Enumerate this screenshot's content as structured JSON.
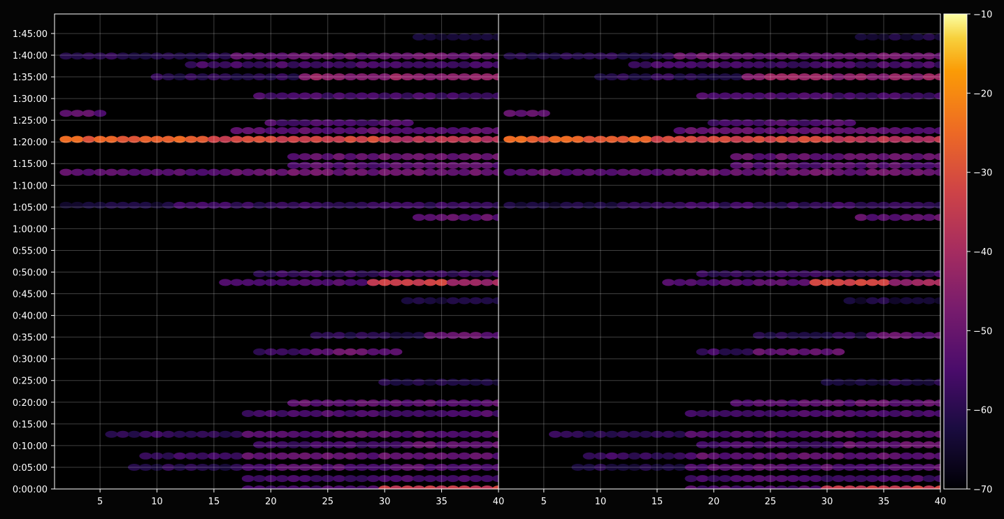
{
  "chart_data": {
    "type": "heatmap",
    "title": "",
    "xlabel": "",
    "ylabel": "",
    "background": "#050505",
    "colormap": "inferno",
    "grid": true,
    "panels": [
      {
        "name": "",
        "x_ticks": [
          5,
          10,
          15,
          20,
          25,
          30,
          35,
          40
        ],
        "x_range": [
          1,
          40
        ]
      },
      {
        "name": "",
        "x_ticks": [
          5,
          10,
          15,
          20,
          25,
          30,
          35,
          40
        ],
        "x_range": [
          1,
          40
        ]
      }
    ],
    "y_ticks": [
      "0:00:00",
      "0:05:00",
      "0:10:00",
      "0:15:00",
      "0:20:00",
      "0:25:00",
      "0:30:00",
      "0:35:00",
      "0:40:00",
      "0:45:00",
      "0:50:00",
      "0:55:00",
      "1:00:00",
      "1:05:00",
      "1:10:00",
      "1:15:00",
      "1:20:00",
      "1:25:00",
      "1:30:00",
      "1:35:00",
      "1:40:00",
      "1:45:00"
    ],
    "y_range_minutes": [
      0,
      109.5
    ],
    "colorbar": {
      "ticks": [
        -10,
        -20,
        -30,
        -40,
        -50,
        -60,
        -70
      ],
      "tick_labels": [
        "−10",
        "−20",
        "−30",
        "−40",
        "−50",
        "−60",
        "−70"
      ],
      "range": [
        -70,
        -10
      ]
    },
    "rows": [
      {
        "t": 0.0,
        "segments": [
          {
            "from": 18,
            "to": 29,
            "level": -55
          },
          {
            "from": 30,
            "to": 40,
            "level": -34
          }
        ]
      },
      {
        "t": 2.4,
        "segments": [
          {
            "from": 18,
            "to": 40,
            "level": -56
          }
        ]
      },
      {
        "t": 5.0,
        "segments": [
          {
            "from": 8,
            "to": 18,
            "level": -61
          },
          {
            "from": 18,
            "to": 40,
            "level": -53
          }
        ]
      },
      {
        "t": 7.6,
        "segments": [
          {
            "from": 9,
            "to": 18,
            "level": -58
          },
          {
            "from": 18,
            "to": 40,
            "level": -52
          }
        ]
      },
      {
        "t": 10.2,
        "segments": [
          {
            "from": 19,
            "to": 32,
            "level": -56
          },
          {
            "from": 32,
            "to": 40,
            "level": -51
          }
        ]
      },
      {
        "t": 12.6,
        "segments": [
          {
            "from": 6,
            "to": 18,
            "level": -59
          },
          {
            "from": 18,
            "to": 40,
            "level": -53
          }
        ]
      },
      {
        "t": 17.4,
        "segments": [
          {
            "from": 18,
            "to": 40,
            "level": -55
          }
        ]
      },
      {
        "t": 19.8,
        "segments": [
          {
            "from": 22,
            "to": 40,
            "level": -52
          }
        ]
      },
      {
        "t": 24.6,
        "segments": [
          {
            "from": 30,
            "to": 40,
            "level": -62
          }
        ]
      },
      {
        "t": 31.6,
        "segments": [
          {
            "from": 19,
            "to": 24,
            "level": -58
          },
          {
            "from": 24,
            "to": 31,
            "level": -50
          }
        ]
      },
      {
        "t": 35.4,
        "segments": [
          {
            "from": 24,
            "to": 34,
            "level": -61
          },
          {
            "from": 34,
            "to": 40,
            "level": -52
          }
        ]
      },
      {
        "t": 43.4,
        "segments": [
          {
            "from": 32,
            "to": 40,
            "level": -63
          }
        ]
      },
      {
        "t": 47.6,
        "segments": [
          {
            "from": 16,
            "to": 29,
            "level": -53
          },
          {
            "from": 29,
            "to": 36,
            "level": -33
          },
          {
            "from": 36,
            "to": 40,
            "level": -42
          }
        ]
      },
      {
        "t": 49.6,
        "segments": [
          {
            "from": 19,
            "to": 40,
            "level": -58
          }
        ]
      },
      {
        "t": 62.6,
        "segments": [
          {
            "from": 33,
            "to": 40,
            "level": -52
          }
        ]
      },
      {
        "t": 65.4,
        "segments": [
          {
            "from": 2,
            "to": 12,
            "level": -63
          },
          {
            "from": 12,
            "to": 40,
            "level": -58
          }
        ]
      },
      {
        "t": 73.0,
        "segments": [
          {
            "from": 2,
            "to": 18,
            "level": -52
          },
          {
            "from": 18,
            "to": 40,
            "level": -50
          }
        ]
      },
      {
        "t": 74.6,
        "segments": [
          {
            "from": 22,
            "to": 40,
            "level": -53
          }
        ]
      },
      {
        "t": 76.6,
        "segments": [
          {
            "from": 22,
            "to": 40,
            "level": -51
          }
        ]
      },
      {
        "t": 80.6,
        "segments": [
          {
            "from": 2,
            "to": 15,
            "level": -27
          },
          {
            "from": 15,
            "to": 31,
            "level": -32
          },
          {
            "from": 31,
            "to": 40,
            "level": -37
          }
        ]
      },
      {
        "t": 82.6,
        "segments": [
          {
            "from": 17,
            "to": 40,
            "level": -52
          }
        ]
      },
      {
        "t": 84.4,
        "segments": [
          {
            "from": 20,
            "to": 32,
            "level": -55
          }
        ]
      },
      {
        "t": 86.6,
        "segments": [
          {
            "from": 2,
            "to": 5,
            "level": -52
          }
        ]
      },
      {
        "t": 90.6,
        "segments": [
          {
            "from": 19,
            "to": 40,
            "level": -56
          }
        ]
      },
      {
        "t": 95.0,
        "segments": [
          {
            "from": 10,
            "to": 23,
            "level": -60
          },
          {
            "from": 23,
            "to": 40,
            "level": -44
          }
        ]
      },
      {
        "t": 97.8,
        "segments": [
          {
            "from": 13,
            "to": 40,
            "level": -56
          }
        ]
      },
      {
        "t": 99.8,
        "segments": [
          {
            "from": 2,
            "to": 17,
            "level": -60
          },
          {
            "from": 17,
            "to": 40,
            "level": -50
          }
        ]
      },
      {
        "t": 104.2,
        "segments": [
          {
            "from": 33,
            "to": 40,
            "level": -63
          }
        ]
      }
    ]
  }
}
